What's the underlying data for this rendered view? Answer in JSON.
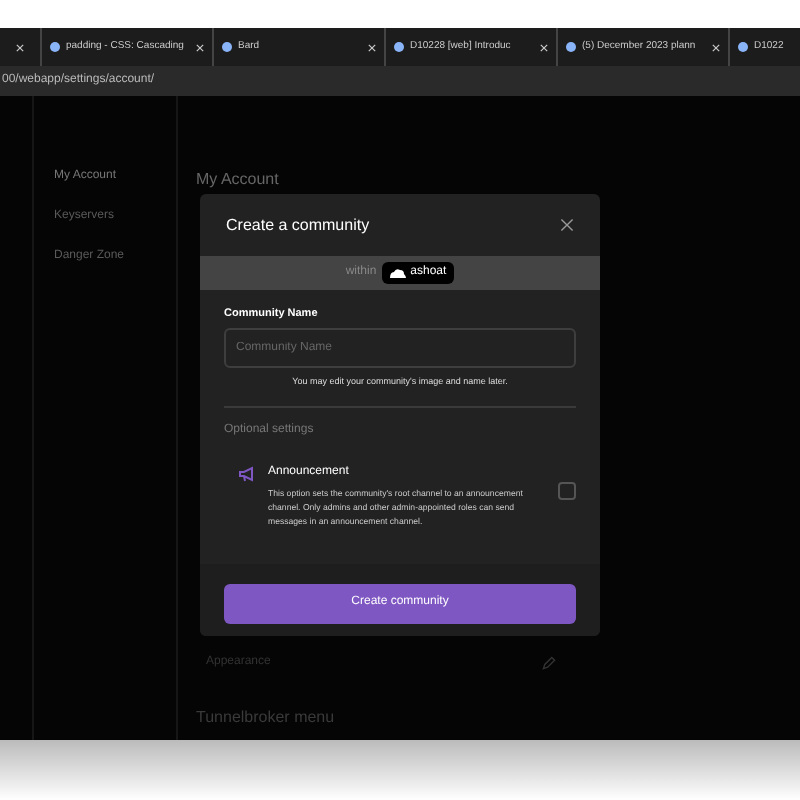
{
  "browser_tabs": [
    {
      "title": "padding - CSS: Cascading",
      "selected": false
    },
    {
      "title": "Bard",
      "selected": false
    },
    {
      "title": "D10228 [web] Introduc",
      "selected": false
    },
    {
      "title": "(5) December 2023 plann",
      "selected": false
    },
    {
      "title": "D1022",
      "selected": false
    }
  ],
  "address": "00/webapp/settings/account/",
  "sidebar": {
    "items": [
      {
        "label": "My Account",
        "selected": true
      },
      {
        "label": "Keyservers",
        "selected": false
      },
      {
        "label": "Danger Zone",
        "selected": false
      }
    ]
  },
  "page": {
    "heading": "My Account",
    "rows": [
      {
        "label": "Appearance"
      }
    ],
    "section": "Tunnelbroker menu"
  },
  "modal": {
    "title": "Create a community",
    "within_label": "within",
    "within_name": "ashoat",
    "field": {
      "label": "Community Name",
      "placeholder": "Community Name",
      "hint": "You may edit your community's image and name later."
    },
    "optional_heading": "Optional settings",
    "options": [
      {
        "title": "Announcement",
        "description": "This option sets the community's root channel to an announcement channel. Only admins and other admin-appointed roles can send messages in an announcement channel.",
        "checked": false
      }
    ],
    "submit": "Create community"
  }
}
